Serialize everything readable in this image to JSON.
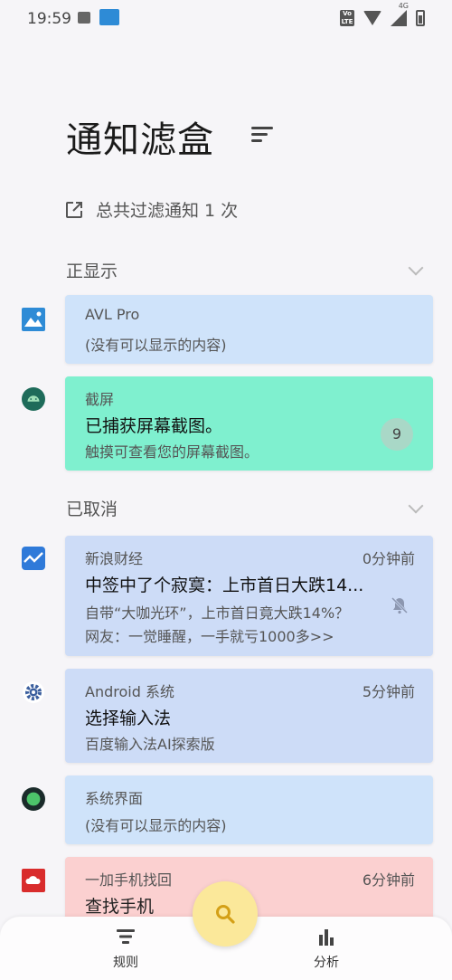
{
  "status_bar": {
    "time": "19:59",
    "network": "4G",
    "volte": "Vo LTE"
  },
  "header": {
    "title": "通知滤盒",
    "filter_summary": "总共过滤通知 1 次"
  },
  "sections": {
    "showing": {
      "label": "正显示"
    },
    "cancelled": {
      "label": "已取消"
    }
  },
  "showing_cards": [
    {
      "app": "AVL Pro",
      "line1": "(没有可以显示的内容)",
      "color": "#cfe3fa",
      "icon": "avl-image-icon"
    },
    {
      "app": "截屏",
      "title": "已捕获屏幕截图。",
      "line1": "触摸可查看您的屏幕截图。",
      "badge": "9",
      "color": "#7ff0cf",
      "icon": "android-icon"
    }
  ],
  "cancelled_cards": [
    {
      "app": "新浪财经",
      "time": "0分钟前",
      "title": "中签中了个寂寞：上市首日大跌14...",
      "line1": "自带“大咖光环”，上市首日竟大跌14%？",
      "line2": "网友：一觉睡醒，一手就亏1000多>>",
      "color": "#cddcf7",
      "icon": "sina-finance-icon"
    },
    {
      "app": "Android 系统",
      "time": "5分钟前",
      "title": "选择输入法",
      "line1": "百度输入法AI探索版",
      "color": "#cddcf7",
      "icon": "gear-icon"
    },
    {
      "app": "系统界面",
      "line1": "(没有可以显示的内容)",
      "color": "#cfe3fa",
      "icon": "system-ui-icon"
    },
    {
      "app": "一加手机找回",
      "time": "6分钟前",
      "title": "查找手机",
      "color": "#fbd0d0",
      "icon": "cloud-icon"
    }
  ],
  "bottom_nav": {
    "rules_label": "规则",
    "analysis_label": "分析"
  },
  "colors": {
    "fab": "#fbe89a",
    "accent_icon": "#d4a017"
  }
}
